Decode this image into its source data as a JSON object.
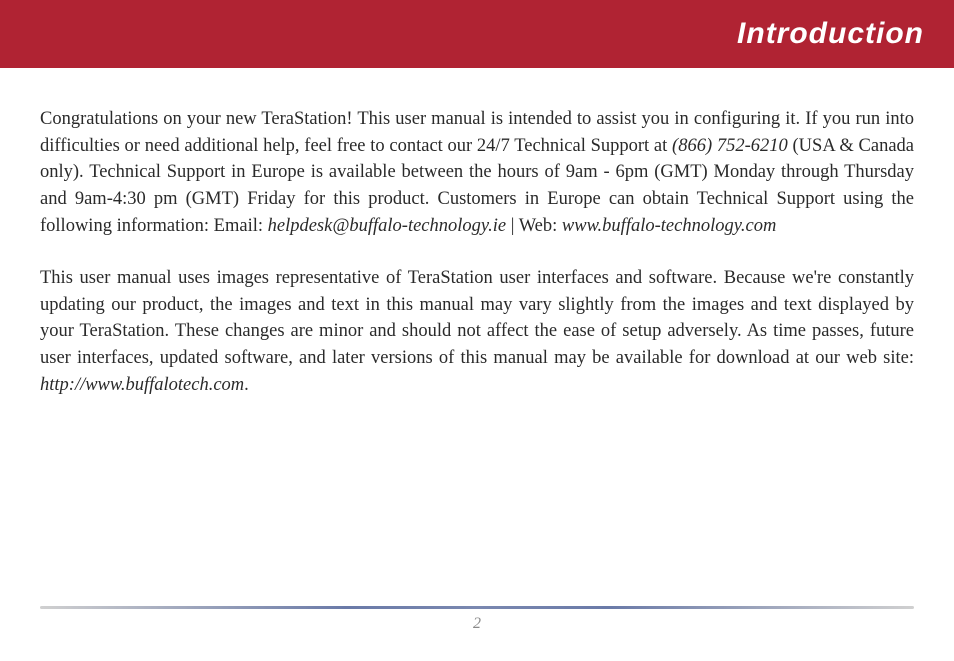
{
  "header": {
    "title": "Introduction"
  },
  "body": {
    "p1a": "Congratulations on your new TeraStation!  This user manual is intended to assist you in configuring it.  If you run into difficulties or need additional help, feel free to contact our 24/7 Technical Support at ",
    "phone": "(866) 752-6210",
    "p1b": " (USA & Canada only).  Technical Support in Europe is available between the hours of 9am - 6pm (GMT) Monday through Thursday and 9am-4:30 pm (GMT) Friday for this product.  Customers in Europe can obtain Technical Support using the following information:  Email:  ",
    "email": "helpdesk@buffalo-technology.ie",
    "p1c": " | Web:  ",
    "web": "www.buffalo-technology.com",
    "p2a": "This user manual uses images representative of TeraStation user interfaces and software.  Because we're constantly updating our product, the images and text in this manual may vary slightly from the images and text displayed by your TeraStation.  These changes are minor and should not affect the ease of setup adversely.  As time passes, future user interfaces, updated software, and later versions of this manual may be available for download at our web site:  ",
    "site": "http://www.buffalotech.com",
    "p2b": "."
  },
  "footer": {
    "page": "2"
  }
}
